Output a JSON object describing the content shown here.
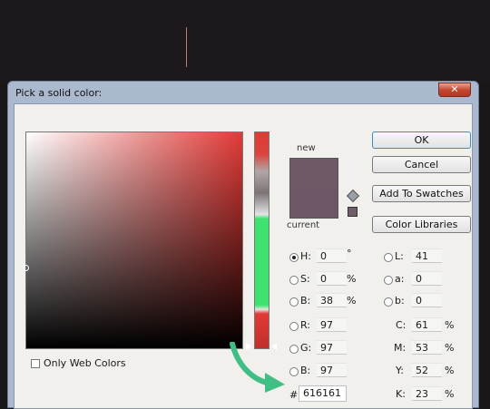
{
  "window": {
    "title": "Pick a solid color:",
    "close_glyph": "✕"
  },
  "preview": {
    "new_label": "new",
    "current_label": "current",
    "new_color": "#6e5a66",
    "current_color": "#6b5766"
  },
  "buttons": {
    "ok": "OK",
    "cancel": "Cancel",
    "add_to_swatches": "Add To Swatches",
    "color_libraries": "Color Libraries"
  },
  "hsb": {
    "h": {
      "label": "H:",
      "value": "0",
      "unit": "°"
    },
    "s": {
      "label": "S:",
      "value": "0",
      "unit": "%"
    },
    "b": {
      "label": "B:",
      "value": "38",
      "unit": "%"
    }
  },
  "rgb": {
    "r": {
      "label": "R:",
      "value": "97"
    },
    "g": {
      "label": "G:",
      "value": "97"
    },
    "b": {
      "label": "B:",
      "value": "97"
    }
  },
  "lab": {
    "l": {
      "label": "L:",
      "value": "41"
    },
    "a": {
      "label": "a:",
      "value": "0"
    },
    "b": {
      "label": "b:",
      "value": "0"
    }
  },
  "cmyk": {
    "c": {
      "label": "C:",
      "value": "61",
      "unit": "%"
    },
    "m": {
      "label": "M:",
      "value": "53",
      "unit": "%"
    },
    "y": {
      "label": "Y:",
      "value": "52",
      "unit": "%"
    },
    "k": {
      "label": "K:",
      "value": "23",
      "unit": "%"
    }
  },
  "hex": {
    "label": "#",
    "value": "616161"
  },
  "web_colors_label": "Only Web Colors",
  "icons": {
    "gamut": "cube-icon",
    "arrow": "green-arrow-icon"
  },
  "accent": {
    "arrow": "#3fbf86"
  }
}
